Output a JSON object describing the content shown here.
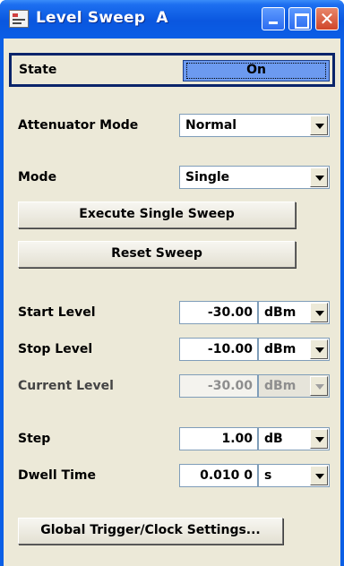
{
  "window": {
    "title": "Level Sweep  A"
  },
  "titlebar": {
    "minimize_icon": "minimize-icon",
    "maximize_icon": "maximize-icon",
    "close_icon": "close-icon",
    "close_glyph": "✕"
  },
  "state": {
    "label": "State",
    "value": "On"
  },
  "attenuator_mode": {
    "label": "Attenuator Mode",
    "value": "Normal"
  },
  "mode": {
    "label": "Mode",
    "value": "Single"
  },
  "buttons": {
    "execute": "Execute Single Sweep",
    "reset": "Reset Sweep",
    "global_trigger": "Global Trigger/Clock Settings..."
  },
  "start_level": {
    "label": "Start Level",
    "value": "-30.00",
    "unit": "dBm"
  },
  "stop_level": {
    "label": "Stop Level",
    "value": "-10.00",
    "unit": "dBm"
  },
  "current_level": {
    "label": "Current Level",
    "value": "-30.00",
    "unit": "dBm"
  },
  "step": {
    "label": "Step",
    "value": "1.00",
    "unit": "dB"
  },
  "dwell_time": {
    "label": "Dwell Time",
    "value": "0.010 0",
    "unit": "s"
  }
}
